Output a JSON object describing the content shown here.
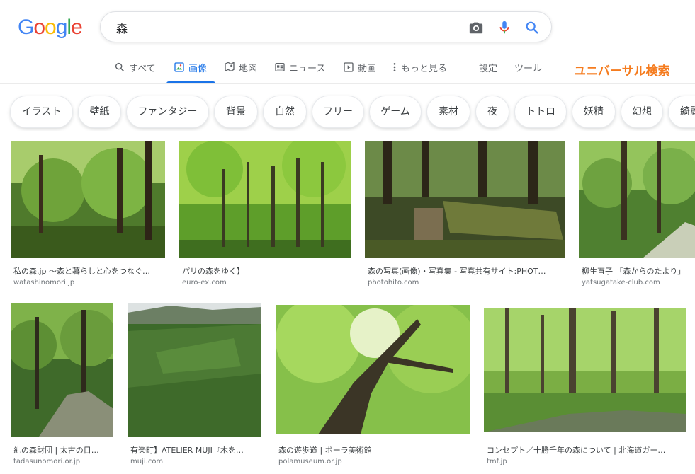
{
  "logo": {
    "letters": [
      "G",
      "o",
      "o",
      "g",
      "l",
      "e"
    ],
    "colors": [
      "#4285f4",
      "#ea4335",
      "#fbbc05",
      "#4285f4",
      "#34a853",
      "#ea4335"
    ]
  },
  "search": {
    "value": "森",
    "camera_icon": "camera-icon",
    "mic_icon": "mic-icon",
    "search_icon": "search-icon"
  },
  "tabs": [
    {
      "label": "すべて",
      "icon": "search-icon"
    },
    {
      "label": "画像",
      "icon": "image-icon"
    },
    {
      "label": "地図",
      "icon": "map-icon"
    },
    {
      "label": "ニュース",
      "icon": "news-icon"
    },
    {
      "label": "動画",
      "icon": "video-icon"
    },
    {
      "label": "もっと見る",
      "icon": "more-icon"
    }
  ],
  "tools": {
    "settings": "設定",
    "tools": "ツール"
  },
  "overlay": {
    "universal_search": "ユニバーサル検索",
    "color": "#f57c1f"
  },
  "chips": [
    "イラスト",
    "壁紙",
    "ファンタジー",
    "背景",
    "自然",
    "フリー",
    "ゲーム",
    "素材",
    "夜",
    "トトロ",
    "妖精",
    "幻想",
    "綺麗"
  ],
  "results": [
    {
      "title": "私の森.jp 〜森と暮らしと心をつなぐ…",
      "source": "watashinomori.jp"
    },
    {
      "title": "パリの森をゆく】",
      "source": "euro-ex.com"
    },
    {
      "title": "森の写真(画像)・写真集 - 写真共有サイト:PHOT…",
      "source": "photohito.com"
    },
    {
      "title": "柳生直子 「森からのたより」",
      "source": "yatsugatake-club.com"
    },
    {
      "title": "糺の森財団 | 太古の目…",
      "source": "tadasunomori.or.jp"
    },
    {
      "title": "有楽町】ATELIER MUJI『木を…",
      "source": "muji.com"
    },
    {
      "title": "森の遊歩道 | ポーラ美術館",
      "source": "polamuseum.or.jp"
    },
    {
      "title": "コンセプト／十勝千年の森について | 北海道ガー…",
      "source": "tmf.jp"
    }
  ]
}
